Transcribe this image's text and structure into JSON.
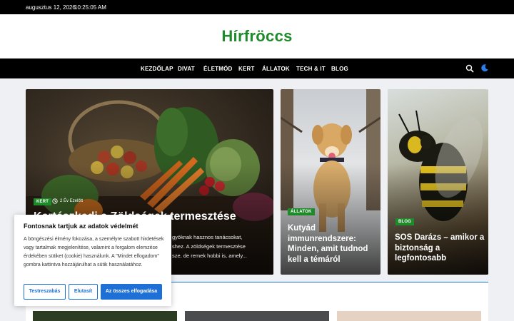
{
  "topbar": {
    "date": "augusztus 12, 2026",
    "time": "10:25:05 AM"
  },
  "site": {
    "title": "Hírfröccs"
  },
  "nav": {
    "items": [
      "KEZDŐLAP",
      "DIVAT",
      "ÉLETMÓD",
      "KERT",
      "ÁLLATOK",
      "TECH & IT",
      "BLOG"
    ],
    "search_icon": "search-icon",
    "theme_icon": "moon-icon"
  },
  "featured": {
    "category": "KERT",
    "time_ago": "2 Év Ezelőtt",
    "title": "Kertészkedj a Zöldségek termesztése",
    "excerpt_line1": "gyöknak hasznos tanácsokat,",
    "excerpt_line2": "shez. A zöldségek termesztése",
    "excerpt_line3": "sze, de remek hobbi is, amely..."
  },
  "card2": {
    "category": "ÁLLATOK",
    "title": "Kutyád immunrendszere: Minden, amit tudnod kell a témáról"
  },
  "card3": {
    "category": "BLOG",
    "title": "SOS Darázs – amikor a biztonság a legfontosabb"
  },
  "cookie": {
    "title": "Fontosnak tartjuk az adatok védelmét",
    "text": "A böngészési élmény fokozása, a személyre szabott hirdetések vagy tartalmak megjelenítése, valamint a forgalom elemzése érdekében sütiket (cookie) használunk. A \"Mindet elfogadom\" gombra kattintva hozzájárulhat a sütik használatához.",
    "customize": "Testreszabás",
    "reject": "Elutasít",
    "accept": "Az összes elfogadása"
  },
  "colors": {
    "brand": "#1f8a2a",
    "accent": "#1e6fd6"
  }
}
